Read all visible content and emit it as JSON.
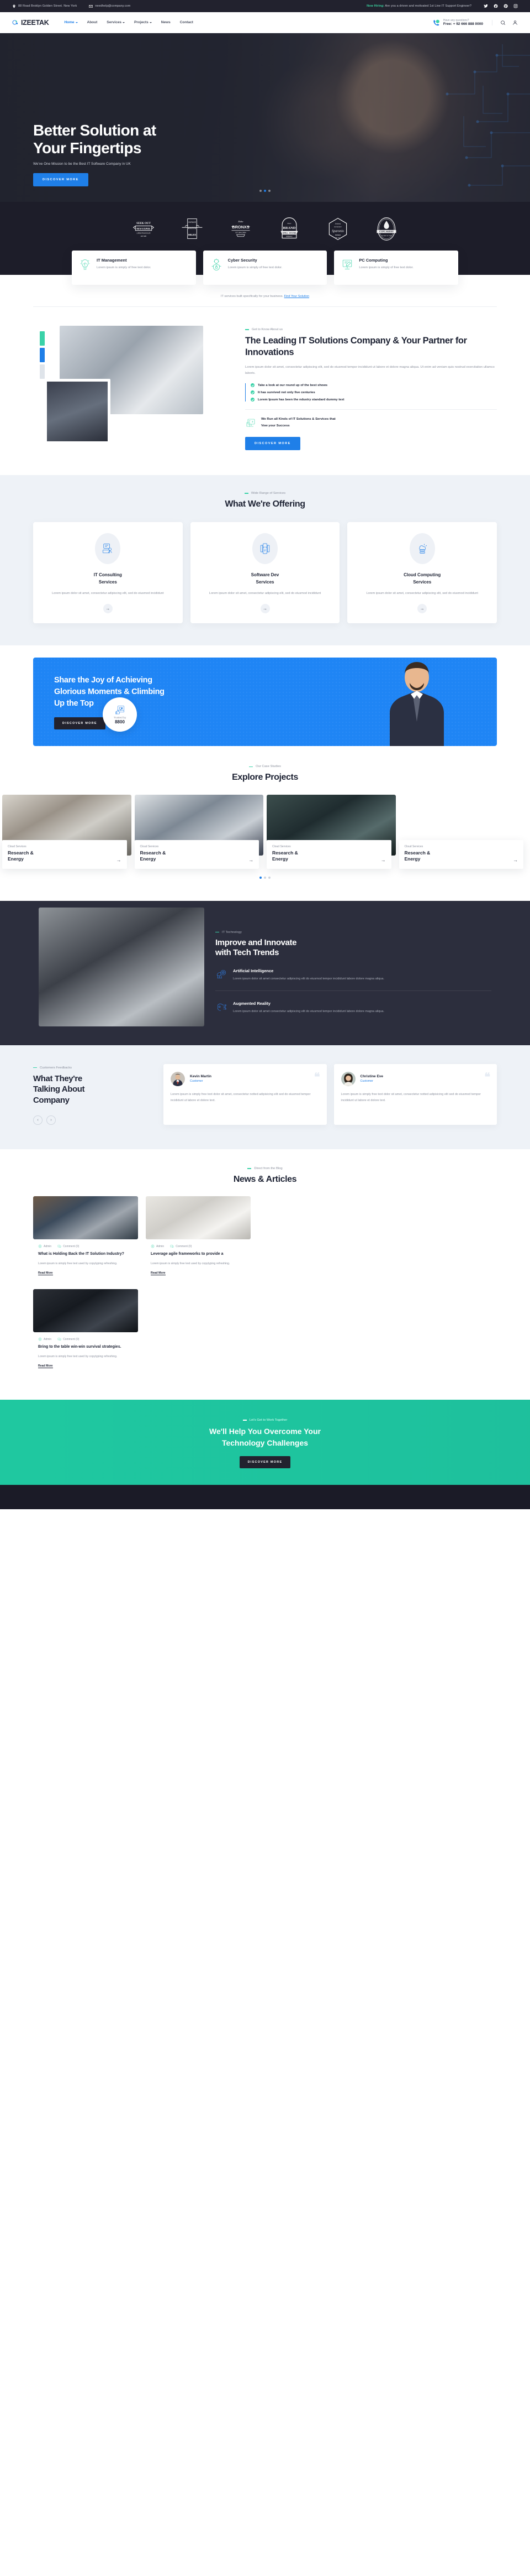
{
  "topbar": {
    "address": "88 Road Broklyn Golden Street. New York",
    "email": "needhelp@company.com",
    "hiring_label": "Now Hiring:",
    "hiring_text": "Are you a driven and motivated 1st Line IT Support Engineer?",
    "socials": [
      "twitter-icon",
      "facebook-icon",
      "pinterest-icon",
      "instagram-icon"
    ]
  },
  "header": {
    "brand": "IZEETAK",
    "nav": [
      {
        "label": "Home",
        "caret": true,
        "active": true
      },
      {
        "label": "About",
        "caret": false,
        "active": false
      },
      {
        "label": "Services",
        "caret": true,
        "active": false
      },
      {
        "label": "Projects",
        "caret": true,
        "active": false
      },
      {
        "label": "News",
        "caret": false,
        "active": false
      },
      {
        "label": "Contact",
        "caret": false,
        "active": false
      }
    ],
    "phone_label": "Have any questions?",
    "phone_number": "Free: + 92 666 888 0000"
  },
  "hero": {
    "title_line1": "Better Solution at",
    "title_line2": "Your Fingertips",
    "subtitle": "We've One Mission to be the Best IT Software Company in UK",
    "cta": "DISCOVER MORE",
    "slide_count": 3,
    "active_slide": 2
  },
  "brands": [
    {
      "name": "seek-out-new-experiences",
      "top": "SEEK OUT",
      "main": "NEW EXPERIENCES",
      "sub": "LOREM IPSUM IS NOT TO THE BEAUTIFULLY",
      "foot": "EST 1985"
    },
    {
      "name": "vintage-retired-miles",
      "top": "VINTAGE",
      "main": "Retired",
      "sub": "MILES"
    },
    {
      "name": "bronxs",
      "top": "Make",
      "main": "BRONXS",
      "sub": "EST ~ 1984 ~ LOREM"
    },
    {
      "name": "brand-grill-house",
      "top": "Since",
      "main": "BRAND",
      "sub": "GRILL HOUSE",
      "foot": "BREWING"
    },
    {
      "name": "sparonio",
      "top": "Deliziosa",
      "main": "Sparonio",
      "sub": "PIZZERIA",
      "foot": "EST. 1971"
    },
    {
      "name": "cupcakery",
      "main": "CUPCAKERY",
      "sub": "THE BEST IN TOWN"
    }
  ],
  "feature_cards": [
    {
      "icon": "lightbulb-fingerprint-icon",
      "title": "IT Management",
      "text": "Lorem ipsum is simply of free text dolor."
    },
    {
      "icon": "shield-lock-gear-icon",
      "title": "Cyber Security",
      "text": "Lorem ipsum is simply of free text dolor."
    },
    {
      "icon": "monitor-pen-icon",
      "title": "PC Computing",
      "text": "Lorem ipsum is simply of free text dolor."
    }
  ],
  "find_solution": {
    "text": "IT services built specifically for your business.",
    "link": "Find Your Solution"
  },
  "about": {
    "eyebrow": "Get to Know About us",
    "title": "The Leading IT Solutions Company & Your Partner for Innovations",
    "paragraph": "Lorem ipsum dolor sit amet, consectetur adipiscing elit, sed do eiusmod tempor incididunt ut labore et dolore magna aliqua. Ut enim ad veniam quis nostrud exercitation ullamco laboris.",
    "checks": [
      "Take a look at our round up of the best shows",
      "It has survived not only five centuries",
      "Lorem Ipsum has been the ndustry standard dummy text"
    ],
    "note_line1": "We Run all Kinds of IT Solutions & Services that",
    "note_line2": "Vow your Success",
    "cta": "DISCOVER MORE",
    "bar_colors": [
      "#3ad2a8",
      "#1f7fe8",
      "#dfe4ea"
    ]
  },
  "offering": {
    "eyebrow": "Wide Range of Services",
    "title": "What We're Offering",
    "cards": [
      {
        "icon": "consulting-screen-icon",
        "title_line1": "IT Consulting",
        "title_line2": "Services",
        "text": "Lorem ipsum dolor sit amet, consectetur adipiscing elit, sed do eiusmod incididunt",
        "arrow": "→"
      },
      {
        "icon": "mobile-code-icon",
        "title_line1": "Software Dev",
        "title_line2": "Services",
        "text": "Lorem ipsum dolor sit amet, consectetur adipiscing elit, sed do eiusmod incididunt",
        "arrow": "→"
      },
      {
        "icon": "cloud-server-icon",
        "title_line1": "Cloud Computing",
        "title_line2": "Services",
        "text": "Lorem ipsum dolor sit amet, consectetur adipiscing elit, sed do eiusmod incididunt",
        "arrow": "→"
      }
    ]
  },
  "cta_blue": {
    "title_line1": "Share the Joy of Achieving",
    "title_line2": "Glorious Moments & Climbing",
    "title_line3": "Up the Top",
    "button": "DISCOVER MORE",
    "badge_icon": "thumbs-up-review-icon",
    "badge_label": "Trusted by",
    "badge_value": "8800"
  },
  "projects": {
    "eyebrow": "Our Case Studies",
    "title": "Explore Projects",
    "items": [
      {
        "category": "Cloud Services",
        "title_line1": "Research &",
        "title_line2": "Energy",
        "arrow": "→"
      },
      {
        "category": "Cloud Services",
        "title_line1": "Research &",
        "title_line2": "Energy",
        "arrow": "→"
      },
      {
        "category": "Cloud Services",
        "title_line1": "Research &",
        "title_line2": "Energy",
        "arrow": "→"
      },
      {
        "category": "Cloud Services",
        "title_line1": "Research &",
        "title_line2": "Energy",
        "arrow": "→"
      }
    ],
    "slide_count": 3,
    "active_slide": 1
  },
  "trends": {
    "eyebrow": "IT Technology",
    "title_line1": "Improve and Innovate",
    "title_line2": "with Tech Trends",
    "items": [
      {
        "icon": "ai-brain-target-icon",
        "title": "Artificial Intelligence",
        "text": "Lorem ipsum dolor sit amet consectetur adipiscing elit do eiusmod tempor incididunt labore dolore magna aliqua."
      },
      {
        "icon": "augmented-reality-icon",
        "title": "Augmented Reality",
        "text": "Lorem ipsum dolor sit amet consectetur adipiscing elit do eiusmod tempor incididunt labore dolore magna aliqua."
      }
    ]
  },
  "testimonials": {
    "eyebrow": "Customers Feedbacks",
    "title_line1": "What They're",
    "title_line2": "Talking About",
    "title_line3": "Company",
    "prev": "‹",
    "next": "›",
    "cards": [
      {
        "name": "Kevin Martin",
        "role": "Customer",
        "text": "Lorem ipsum is simply free text dolor sit amet, consectetur notted adipisicing elit sed do eiusmod tempor incididunt ut labore et dolore text.",
        "quote": "❝"
      },
      {
        "name": "Christine Eve",
        "role": "Customer",
        "text": "Lorem ipsum is simply free text dolor sit amet, consectetur notted adipisicing elit sed do eiusmod tempor incididunt ut labore et dolore text.",
        "quote": "❝"
      }
    ]
  },
  "news": {
    "eyebrow": "Direct from the Blog",
    "title": "News & Articles",
    "posts": [
      {
        "author": "Admin",
        "comments": "Comment (0)",
        "title": "What is Holding Back the IT Solution Industry?",
        "excerpt": "Lorem ipsum is simply free text used by copytyping refreshing.",
        "readmore": "Read More",
        "image": "hands-on-laptop-photo"
      },
      {
        "author": "Admin",
        "comments": "Comment (0)",
        "title": "Leverage agile frameworks to provide a",
        "excerpt": "Lorem ipsum is simply free text used by copytyping refreshing.",
        "readmore": "Read More",
        "image": "white-robot-photo"
      },
      {
        "author": "Admin",
        "comments": "Comment (0)",
        "title": "Bring to the table win-win survival strategies.",
        "excerpt": "Lorem ipsum is simply free text used by copytyping refreshing.",
        "readmore": "Read More",
        "image": "server-rack-photo"
      }
    ]
  },
  "footer_cta": {
    "eyebrow": "Let's Get to Work Together",
    "title_line1": "We'll Help You Overcome Your",
    "title_line2": "Technology Challenges",
    "button": "DISCOVER MORE"
  },
  "colors": {
    "primary_blue": "#1f7fe8",
    "accent_teal": "#3ad2a8",
    "dark": "#22222e",
    "cta_blue": "#1f85f5",
    "foot_green": "#2ecfa8"
  }
}
